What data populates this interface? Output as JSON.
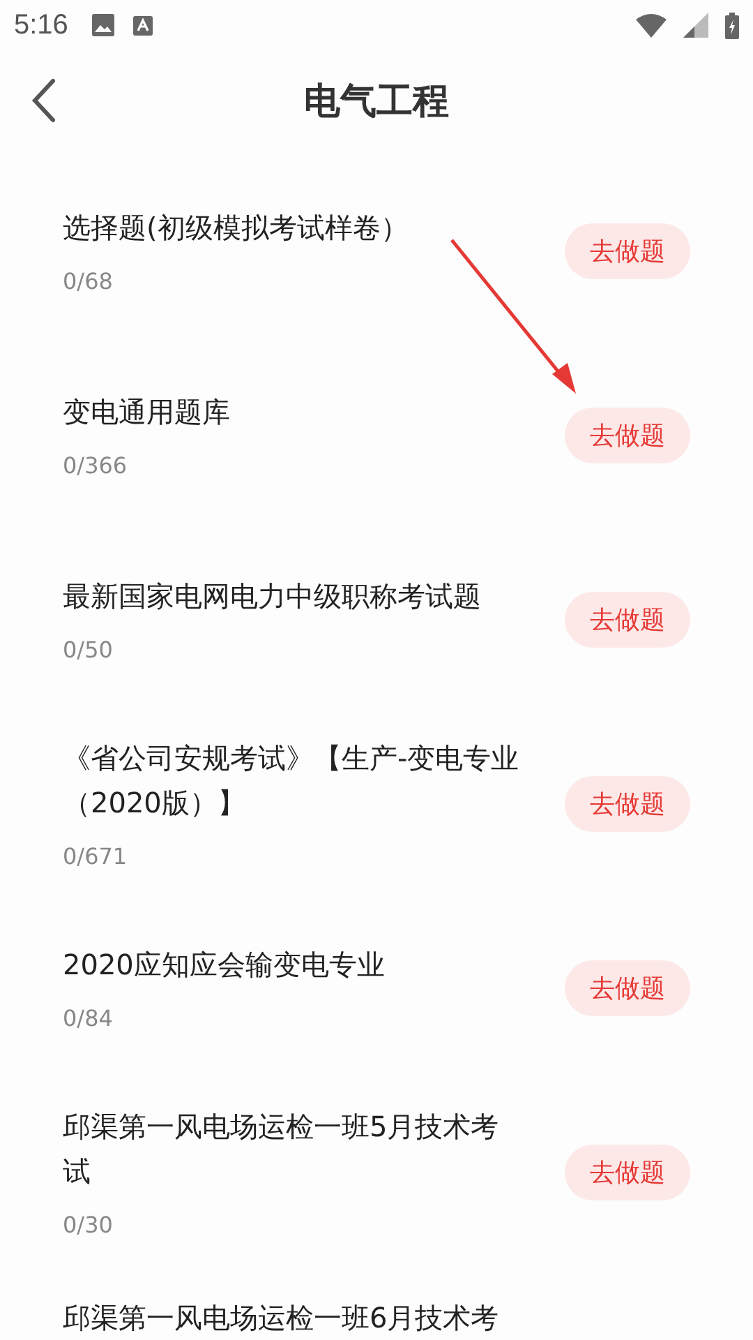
{
  "status_bar": {
    "time": "5:16"
  },
  "header": {
    "title": "电气工程"
  },
  "items": [
    {
      "title": "选择题(初级模拟考试样卷）",
      "count": "0/68",
      "button": "去做题"
    },
    {
      "title": "变电通用题库",
      "count": "0/366",
      "button": "去做题"
    },
    {
      "title": "最新国家电网电力中级职称考试题",
      "count": "0/50",
      "button": "去做题"
    },
    {
      "title": "《省公司安规考试》【生产-变电专业（2020版）】",
      "count": "0/671",
      "button": "去做题"
    },
    {
      "title": "2020应知应会输变电专业",
      "count": "0/84",
      "button": "去做题"
    },
    {
      "title": "邱渠第一风电场运检一班5月技术考试",
      "count": "0/30",
      "button": "去做题"
    },
    {
      "title": "邱渠第一风电场运检一班6月技术考"
    }
  ]
}
